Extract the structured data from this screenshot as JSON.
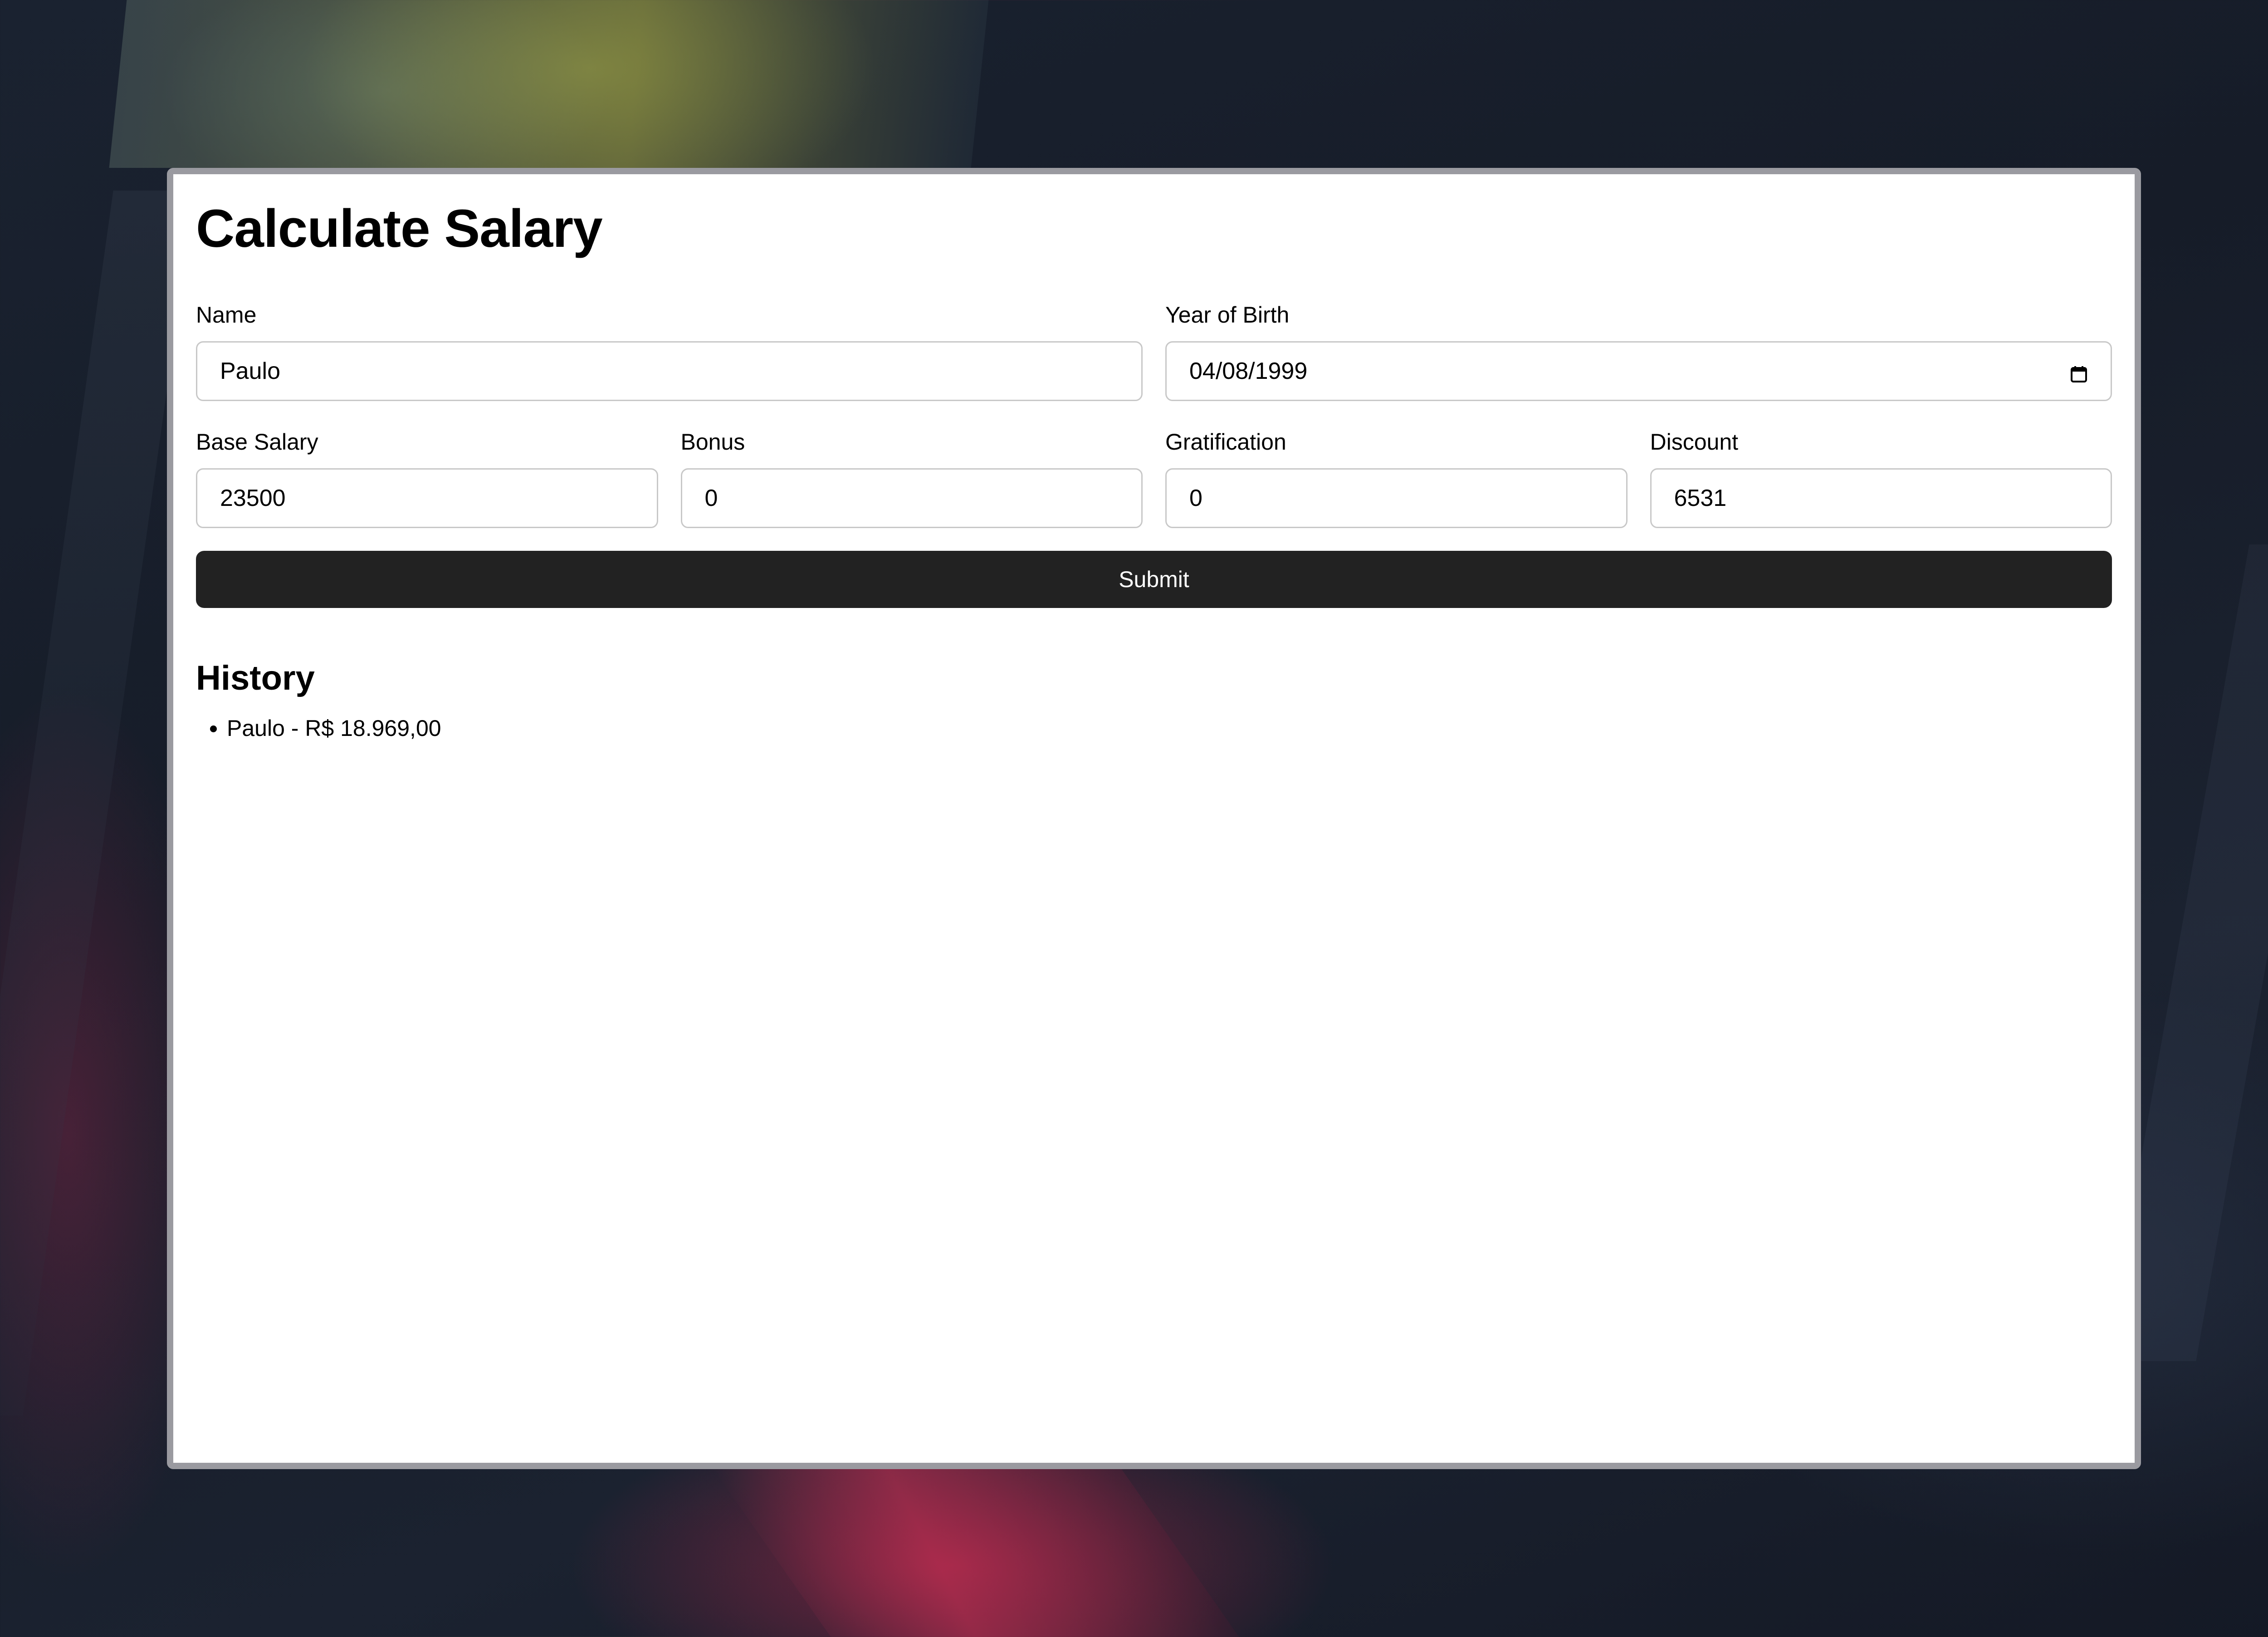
{
  "app": {
    "title": "Calculate Salary"
  },
  "form": {
    "name": {
      "label": "Name",
      "value": "Paulo"
    },
    "birth": {
      "label": "Year of Birth",
      "value": "04/08/1999",
      "icon": "calendar-icon"
    },
    "base_salary": {
      "label": "Base Salary",
      "value": "23500"
    },
    "bonus": {
      "label": "Bonus",
      "value": "0"
    },
    "gratification": {
      "label": "Gratification",
      "value": "0"
    },
    "discount": {
      "label": "Discount",
      "value": "6531"
    },
    "submit_label": "Submit"
  },
  "history": {
    "title": "History",
    "items": [
      {
        "text": "Paulo - R$ 18.969,00"
      }
    ]
  },
  "colors": {
    "button_bg": "#222222",
    "button_text": "#ffffff",
    "card_bg": "#ffffff",
    "window_border": "#9a9aa0"
  }
}
